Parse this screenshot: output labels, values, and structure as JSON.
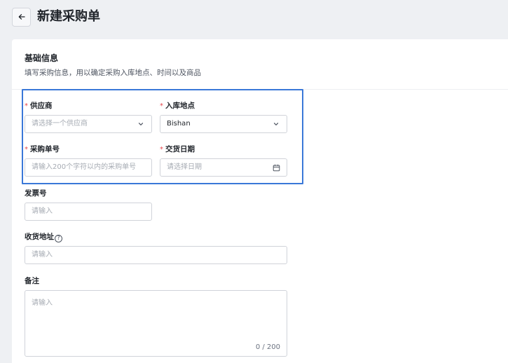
{
  "header": {
    "title": "新建采购单"
  },
  "basic_info": {
    "title": "基础信息",
    "description": "填写采购信息，用以确定采购入库地点、时间以及商品"
  },
  "fields": {
    "supplier": {
      "label": "供应商",
      "placeholder": "请选择一个供应商"
    },
    "warehouse": {
      "label": "入库地点",
      "value": "Bishan"
    },
    "po_number": {
      "label": "采购单号",
      "placeholder": "请输入200个字符以内的采购单号"
    },
    "delivery_date": {
      "label": "交货日期",
      "placeholder": "请选择日期"
    },
    "invoice_number": {
      "label": "发票号",
      "placeholder": "请输入"
    },
    "receiving_address": {
      "label": "收货地址",
      "placeholder": "请输入"
    },
    "remarks": {
      "label": "备注",
      "placeholder": "请输入",
      "counter": "0 / 200"
    }
  },
  "required_mark": "*",
  "colors": {
    "highlight": "#3a78d8",
    "required": "#e5484d",
    "background": "#eef0f3"
  },
  "icons": {
    "back": "arrow-left-icon",
    "select": "chevron-down-icon",
    "date": "calendar-icon",
    "help": "question-circle-icon"
  }
}
